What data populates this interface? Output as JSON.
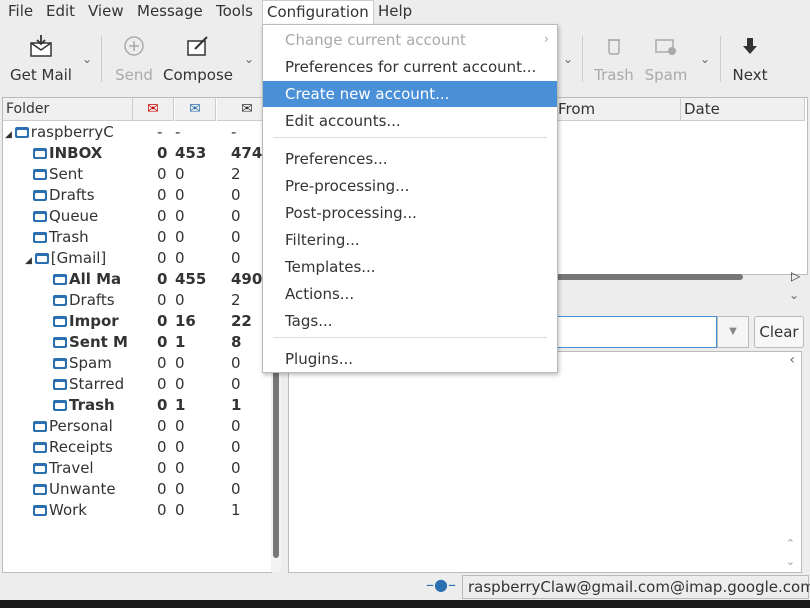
{
  "menubar": [
    "File",
    "Edit",
    "View",
    "Message",
    "Tools",
    "Configuration",
    "Help"
  ],
  "toolbar": {
    "get_mail": "Get Mail",
    "send": "Send",
    "compose": "Compose",
    "trash": "Trash",
    "spam": "Spam",
    "next": "Next"
  },
  "folder_header": "Folder",
  "folders": [
    {
      "name": "raspberryC",
      "new": "-",
      "unread": "-",
      "total": "-",
      "bold": false
    },
    {
      "name": "INBOX",
      "new": "0",
      "unread": "453",
      "total": "474",
      "bold": true
    },
    {
      "name": "Sent",
      "new": "0",
      "unread": "0",
      "total": "2",
      "bold": false
    },
    {
      "name": "Drafts",
      "new": "0",
      "unread": "0",
      "total": "0",
      "bold": false
    },
    {
      "name": "Queue",
      "new": "0",
      "unread": "0",
      "total": "0",
      "bold": false
    },
    {
      "name": "Trash",
      "new": "0",
      "unread": "0",
      "total": "0",
      "bold": false
    },
    {
      "name": "[Gmail]",
      "new": "0",
      "unread": "0",
      "total": "0",
      "bold": false
    },
    {
      "name": "All Ma",
      "new": "0",
      "unread": "455",
      "total": "490",
      "bold": true
    },
    {
      "name": "Drafts",
      "new": "0",
      "unread": "0",
      "total": "2",
      "bold": false
    },
    {
      "name": "Impor",
      "new": "0",
      "unread": "16",
      "total": "22",
      "bold": true
    },
    {
      "name": "Sent M",
      "new": "0",
      "unread": "1",
      "total": "8",
      "bold": true
    },
    {
      "name": "Spam",
      "new": "0",
      "unread": "0",
      "total": "0",
      "bold": false
    },
    {
      "name": "Starred",
      "new": "0",
      "unread": "0",
      "total": "0",
      "bold": false
    },
    {
      "name": "Trash",
      "new": "0",
      "unread": "1",
      "total": "1",
      "bold": true
    },
    {
      "name": "Personal",
      "new": "0",
      "unread": "0",
      "total": "0",
      "bold": false
    },
    {
      "name": "Receipts",
      "new": "0",
      "unread": "0",
      "total": "0",
      "bold": false
    },
    {
      "name": "Travel",
      "new": "0",
      "unread": "0",
      "total": "0",
      "bold": false
    },
    {
      "name": "Unwante",
      "new": "0",
      "unread": "0",
      "total": "0",
      "bold": false
    },
    {
      "name": "Work",
      "new": "0",
      "unread": "0",
      "total": "1",
      "bold": false
    }
  ],
  "message_list": {
    "col_from": "From",
    "col_date": "Date"
  },
  "search": {
    "clear": "Clear"
  },
  "status": {
    "account": "raspberryClaw@gmail.com@imap.google.com"
  },
  "config_menu": {
    "items": [
      {
        "label": "Change current account",
        "disabled": true,
        "submenu": true
      },
      {
        "label": "Preferences for current account...",
        "disabled": false
      },
      {
        "label": "Create new account...",
        "disabled": false,
        "highlighted": true
      },
      {
        "label": "Edit accounts...",
        "disabled": false
      },
      {
        "label": "Preferences...",
        "disabled": false
      },
      {
        "label": "Pre-processing...",
        "disabled": false
      },
      {
        "label": "Post-processing...",
        "disabled": false
      },
      {
        "label": "Filtering...",
        "disabled": false
      },
      {
        "label": "Templates...",
        "disabled": false
      },
      {
        "label": "Actions...",
        "disabled": false
      },
      {
        "label": "Tags...",
        "disabled": false
      },
      {
        "label": "Plugins...",
        "disabled": false
      }
    ]
  },
  "colors": {
    "highlight": "#4a90d9",
    "folder_icon": "#2a6fb0"
  }
}
